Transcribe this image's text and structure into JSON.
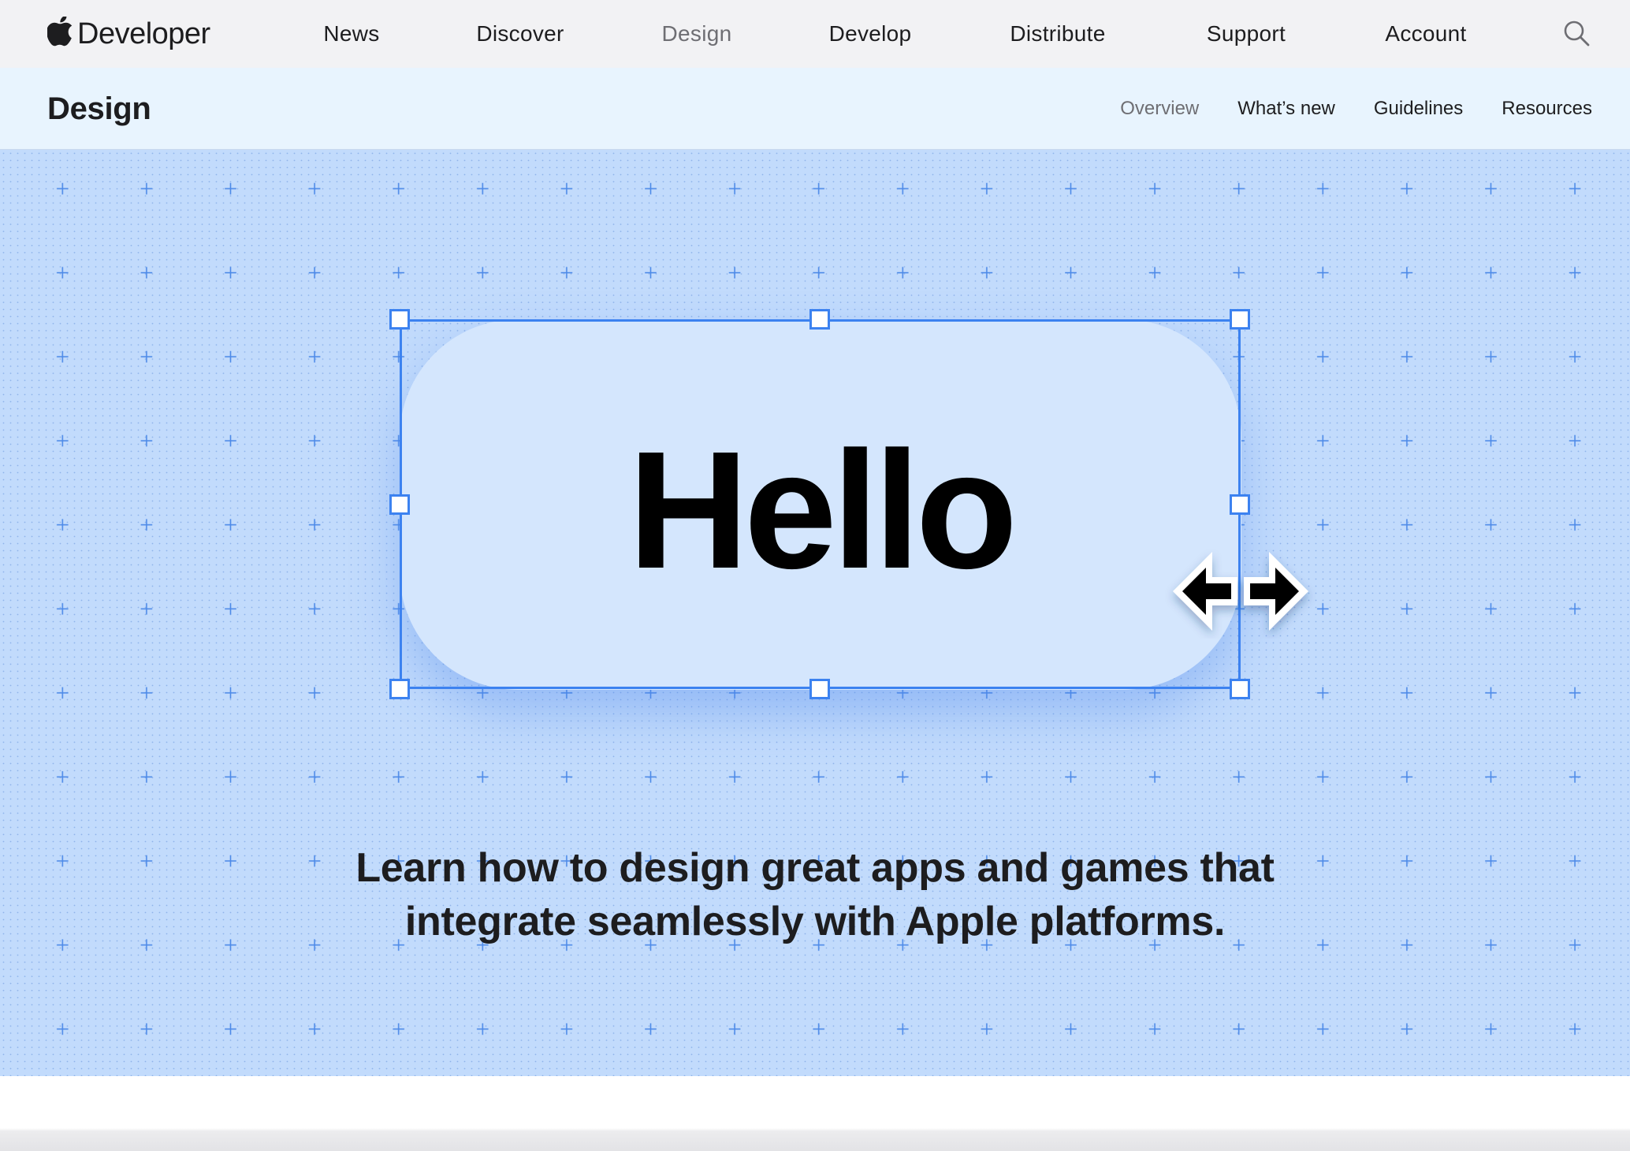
{
  "globalnav": {
    "brand": {
      "logo_icon": "apple-logo-icon",
      "label": "Developer"
    },
    "items": [
      {
        "label": "News",
        "current": false
      },
      {
        "label": "Discover",
        "current": false
      },
      {
        "label": "Design",
        "current": true
      },
      {
        "label": "Develop",
        "current": false
      },
      {
        "label": "Distribute",
        "current": false
      },
      {
        "label": "Support",
        "current": false
      },
      {
        "label": "Account",
        "current": false
      }
    ],
    "search_icon": "search-icon"
  },
  "localnav": {
    "title": "Design",
    "items": [
      {
        "label": "Overview",
        "current": true
      },
      {
        "label": "What’s new",
        "current": false
      },
      {
        "label": "Guidelines",
        "current": false
      },
      {
        "label": "Resources",
        "current": false
      }
    ]
  },
  "hero": {
    "card_text": "Hello",
    "cursor_icon": "horizontal-resize-cursor-icon",
    "tagline_lines": [
      "Learn how to design great apps and games that",
      "integrate seamlessly with Apple platforms."
    ]
  },
  "colors": {
    "hero_background": "#c2dbfc",
    "card_background": "#d4e6fd",
    "selection_blue": "#3c82f0",
    "localnav_background": "#e8f4fe",
    "globalnav_background": "#f2f2f4",
    "text_primary": "#1d1d1f",
    "text_current": "#6e6e73"
  }
}
